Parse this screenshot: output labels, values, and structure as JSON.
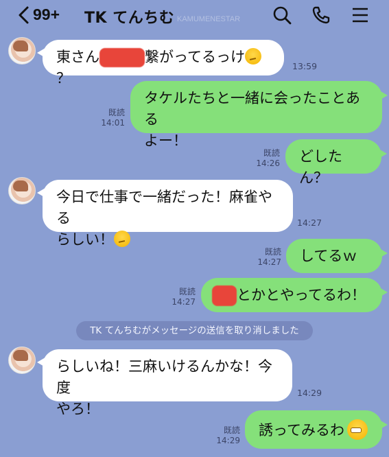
{
  "header": {
    "unread_badge": "99+",
    "title": "TK てんちむ",
    "watermark": "KAMUMENESTAR",
    "icons": [
      "chevron-left-icon",
      "search-icon",
      "phone-icon",
      "menu-icon"
    ]
  },
  "messages": [
    {
      "side": "left",
      "text_before": "東さん",
      "text_after": "繋がってるっけ",
      "suffix": "？",
      "time": "13:59"
    },
    {
      "side": "right",
      "lines": [
        "タケルたちと一緒に会ったことある",
        "よー！"
      ],
      "read": "既読",
      "time": "14:01"
    },
    {
      "side": "right",
      "text": "どしたん？",
      "read": "既読",
      "time": "14:26"
    },
    {
      "side": "left",
      "lines": [
        "今日で仕事で一緒だった！麻雀やる",
        "らしい！"
      ],
      "time": "14:27"
    },
    {
      "side": "right",
      "text": "してるｗ",
      "read": "既読",
      "time": "14:27"
    },
    {
      "side": "right",
      "text_after": "とかとやってるわ！",
      "read": "既読",
      "time": "14:27"
    },
    {
      "side": "left",
      "lines": [
        "らしいね！三麻いけるんかな！今度",
        "やろ！"
      ],
      "time": "14:29"
    },
    {
      "side": "right",
      "text": "誘ってみるわ",
      "read": "既読",
      "time": "14:29"
    }
  ],
  "system_notice": "TK てんちむがメッセージの送信を取り消しました",
  "colors": {
    "background": "#8a9ed2",
    "sent_bubble": "#85e07a",
    "received_bubble": "#ffffff",
    "redaction": "#e8453a"
  }
}
